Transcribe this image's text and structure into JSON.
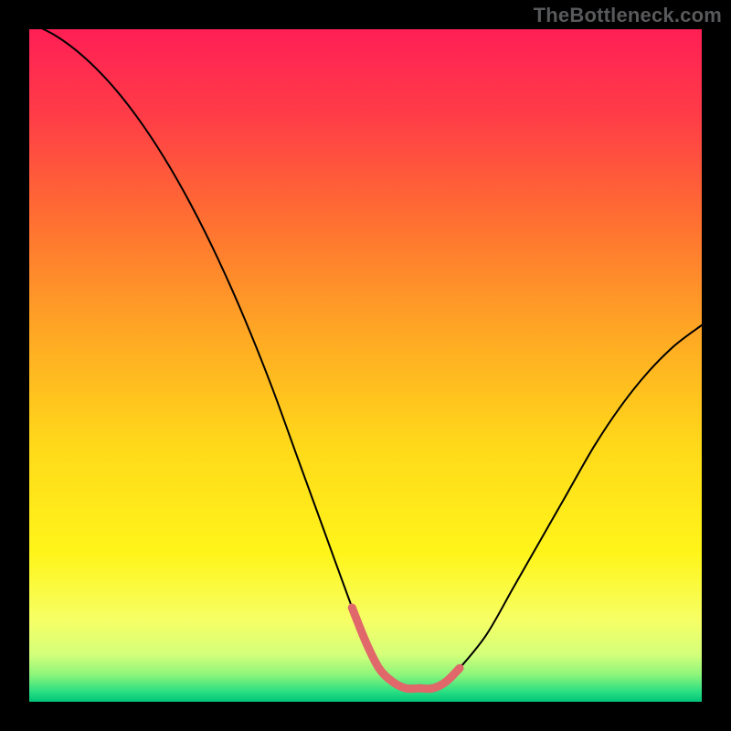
{
  "attribution": "TheBottleneck.com",
  "chart_data": {
    "type": "line",
    "title": "",
    "xlabel": "",
    "ylabel": "",
    "xlim": [
      0,
      100
    ],
    "ylim": [
      0,
      100
    ],
    "x": [
      0,
      4,
      8,
      12,
      16,
      20,
      24,
      28,
      32,
      36,
      40,
      44,
      48,
      50,
      52,
      54,
      56,
      58,
      60,
      62,
      64,
      68,
      72,
      76,
      80,
      84,
      88,
      92,
      96,
      100
    ],
    "values": [
      101,
      99,
      96,
      92,
      87,
      81,
      74,
      66,
      57,
      47,
      36,
      25,
      14,
      9,
      5,
      3,
      2,
      2,
      2,
      3,
      5,
      10,
      17,
      24,
      31,
      38,
      44,
      49,
      53,
      56
    ],
    "highlight_region": {
      "x": [
        48,
        50,
        52,
        54,
        56,
        58,
        60,
        62,
        64
      ],
      "values": [
        14,
        9,
        5,
        3,
        2,
        2,
        2,
        3,
        5
      ]
    },
    "background_gradient_stops": [
      {
        "pos": 0.0,
        "color": "#ff1f55"
      },
      {
        "pos": 0.13,
        "color": "#ff3d47"
      },
      {
        "pos": 0.28,
        "color": "#ff6e32"
      },
      {
        "pos": 0.45,
        "color": "#ffa724"
      },
      {
        "pos": 0.62,
        "color": "#ffd91a"
      },
      {
        "pos": 0.78,
        "color": "#fff51a"
      },
      {
        "pos": 0.88,
        "color": "#f6ff66"
      },
      {
        "pos": 0.93,
        "color": "#d3ff7a"
      },
      {
        "pos": 0.96,
        "color": "#8cf57a"
      },
      {
        "pos": 0.985,
        "color": "#2adf82"
      },
      {
        "pos": 1.0,
        "color": "#00c47a"
      }
    ],
    "curve_color": "#000000",
    "highlight_color": "#e0676a"
  }
}
